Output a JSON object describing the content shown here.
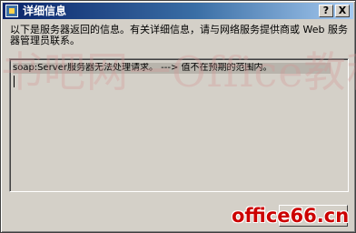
{
  "window": {
    "title": "详细信息",
    "help_label": "?",
    "close_label": "X"
  },
  "message": {
    "description": "以下是服务器返回的信息。有关详细信息，请与网络服务提供商或 Web 服务器管理员联系。",
    "detail": "soap:Server服务器无法处理请求。 ---> 值不在预期的范围内。"
  },
  "watermark": {
    "background_text": "书吧网一Office教程网",
    "logo_text": "office66.cn"
  },
  "colors": {
    "titlebar_start": "#0a246a",
    "titlebar_end": "#a6caf0",
    "dialog_face": "#d4d0c8",
    "logo_red": "#cc0000"
  },
  "icons": {
    "title_icon": "dialog-info-icon"
  }
}
